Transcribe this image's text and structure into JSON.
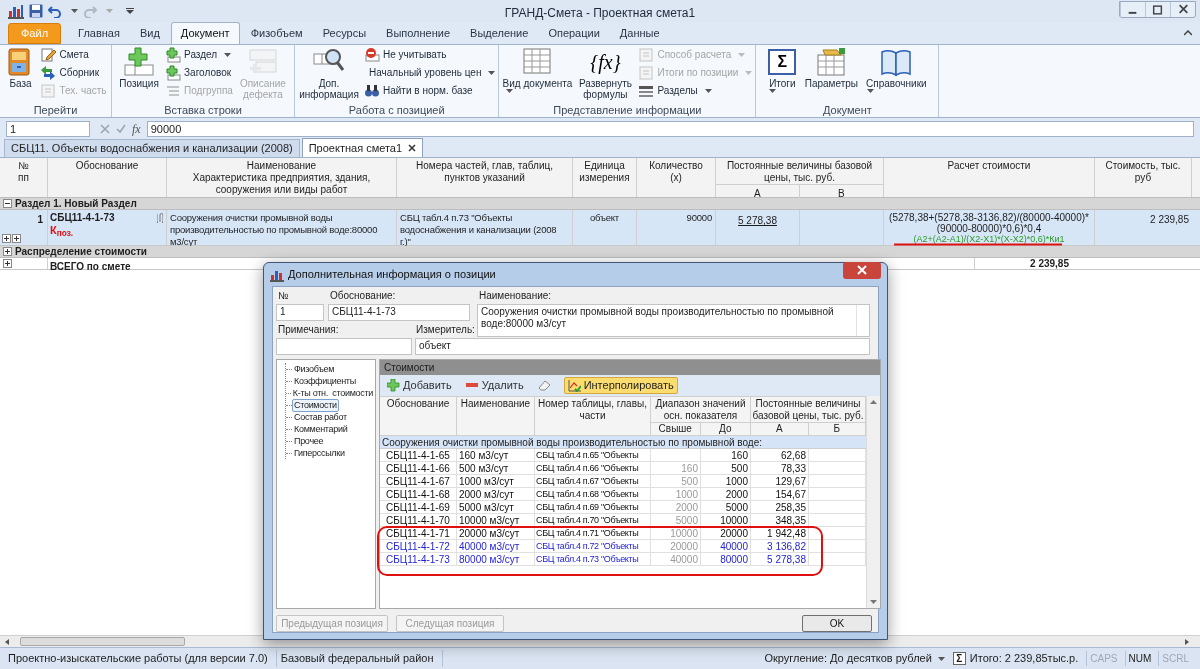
{
  "window": {
    "title": "ГРАНД-Смета - Проектная смета1"
  },
  "ribbon_tabs": [
    {
      "label": "Файл",
      "kind": "file",
      "selected": false
    },
    {
      "label": "Главная",
      "kind": "tab",
      "selected": false
    },
    {
      "label": "Вид",
      "kind": "tab",
      "selected": false
    },
    {
      "label": "Документ",
      "kind": "tab",
      "selected": true
    },
    {
      "label": "Физобъем",
      "kind": "tab",
      "selected": false
    },
    {
      "label": "Ресурсы",
      "kind": "tab",
      "selected": false
    },
    {
      "label": "Выполнение",
      "kind": "tab",
      "selected": false
    },
    {
      "label": "Выделение",
      "kind": "tab",
      "selected": false
    },
    {
      "label": "Операции",
      "kind": "tab",
      "selected": false
    },
    {
      "label": "Данные",
      "kind": "tab",
      "selected": false
    }
  ],
  "ribbon_groups": [
    {
      "title": "Перейти",
      "items": [
        {
          "kind": "large",
          "label": "База",
          "disabled": false,
          "dropdown": false
        },
        {
          "kind": "small",
          "label": "Смета",
          "disabled": false,
          "dropdown": false
        },
        {
          "kind": "small",
          "label": "Сборник",
          "disabled": false,
          "dropdown": false
        },
        {
          "kind": "small",
          "label": "Тех. часть",
          "disabled": true,
          "dropdown": false
        }
      ]
    },
    {
      "title": "Вставка строки",
      "items": [
        {
          "kind": "large",
          "label": "Позиция",
          "disabled": false,
          "dropdown": false
        },
        {
          "kind": "small",
          "label": "Раздел",
          "disabled": false,
          "dropdown": true
        },
        {
          "kind": "small",
          "label": "Заголовок",
          "disabled": false,
          "dropdown": false
        },
        {
          "kind": "small",
          "label": "Подгруппа",
          "disabled": true,
          "dropdown": false
        },
        {
          "kind": "large",
          "label": "Описание дефекта",
          "disabled": true,
          "dropdown": false
        }
      ]
    },
    {
      "title": "Работа с позицией",
      "items": [
        {
          "kind": "large",
          "label": "Доп. информация",
          "disabled": false,
          "dropdown": false
        },
        {
          "kind": "small",
          "label": "Не учитывать",
          "disabled": false,
          "dropdown": false
        },
        {
          "kind": "small",
          "label": "Начальный уровень цен",
          "disabled": false,
          "dropdown": true
        },
        {
          "kind": "small",
          "label": "Найти в норм. базе",
          "disabled": false,
          "dropdown": false
        }
      ]
    },
    {
      "title": "Представление информации",
      "items": [
        {
          "kind": "large",
          "label": "Вид документа",
          "disabled": false,
          "dropdown": true
        },
        {
          "kind": "large",
          "label": "Развернуть формулы",
          "icon_text": "{fx}",
          "disabled": false,
          "dropdown": false
        },
        {
          "kind": "small",
          "label": "Способ расчета",
          "disabled": true,
          "dropdown": true
        },
        {
          "kind": "small",
          "label": "Итоги по позиции",
          "disabled": true,
          "dropdown": true
        },
        {
          "kind": "small",
          "label": "Разделы",
          "disabled": false,
          "dropdown": true
        }
      ]
    },
    {
      "title": "Документ",
      "items": [
        {
          "kind": "large",
          "label": "Итоги",
          "icon_text": "Σ",
          "disabled": false,
          "dropdown": true
        },
        {
          "kind": "large",
          "label": "Параметры",
          "disabled": false,
          "dropdown": false
        },
        {
          "kind": "large",
          "label": "Справочники",
          "disabled": false,
          "dropdown": true
        }
      ]
    }
  ],
  "formula_bar": {
    "cell": "1",
    "function_label": "fx",
    "value": "90000"
  },
  "document_tabs": [
    {
      "label": "СБЦ11. Объекты водоснабжения и канализации (2008)",
      "selected": false
    },
    {
      "label": "Проектная смета1",
      "selected": true
    }
  ],
  "grid": {
    "columns": [
      {
        "label": "№ пп"
      },
      {
        "label": "Обоснование"
      },
      {
        "label": "Наименование\nХарактеристика предприятия, здания, сооружения или виды работ"
      },
      {
        "label": "Номера частей, глав, таблиц, пунктов указаний"
      },
      {
        "label": "Единица измерения"
      },
      {
        "label": "Количество\n(x)"
      },
      {
        "label": "Постоянные величины базовой цены, тыс. руб.",
        "subcolumns": [
          "А",
          "В"
        ]
      },
      {
        "label": "Расчет стоимости"
      },
      {
        "label": "Стоимость, тыс. руб"
      }
    ],
    "rows": [
      {
        "kind": "section",
        "label": "Раздел 1. Новый Раздел",
        "expanded": true
      },
      {
        "kind": "position",
        "selected": true,
        "number": "1",
        "code": "СБЦ11-4-1-73",
        "mark": "К$_{поз.}$",
        "name": "Сооружения очистки промывной воды производительностью по промывной воде:80000 м3/сут",
        "parts": "СБЦ табл.4 п.73 \"Объекты водоснабжения и канализации (2008 г.)\"",
        "unit": "объект",
        "quantity": "90000",
        "a": "5 278,38",
        "formula": "(5278,38+(5278,38-3136,82)/(80000-40000)*(90000-80000)*0,6)*0,4",
        "formula_symbolic": "(A2+(A2-A1)/(X2-X1)*(X-X2)*0,6)*Ки1",
        "cost": "2 239,85"
      },
      {
        "kind": "section",
        "label": "Распределение стоимости",
        "expanded": false
      },
      {
        "kind": "total",
        "label": "ВСЕГО по смете",
        "cost": "2 239,85"
      }
    ]
  },
  "dialog": {
    "title": "Дополнительная информация о позиции",
    "fields": [
      {
        "label": "№",
        "value": "1"
      },
      {
        "label": "Обоснование:",
        "value": "СБЦ11-4-1-73"
      },
      {
        "label": "Наименование:",
        "value": "Сооружения очистки промывной воды производительностью по промывной воде:80000 м3/сут"
      },
      {
        "label": "Примечания:"
      },
      {
        "label": "Измеритель:",
        "value": "объект"
      }
    ],
    "nav": [
      {
        "label": "Физобъем",
        "selected": false
      },
      {
        "label": "Коэффициенты",
        "selected": false
      },
      {
        "label": "К-ты отн.  стоимости",
        "selected": false
      },
      {
        "label": "Стоимости",
        "selected": true
      },
      {
        "label": "Состав работ",
        "selected": false
      },
      {
        "label": "Комментарий",
        "selected": false
      },
      {
        "label": "Прочее",
        "selected": false
      },
      {
        "label": "Гиперссылки",
        "selected": false
      }
    ],
    "panel_title": "Стоимости",
    "toolbar": [
      {
        "kind": "add",
        "label": "Добавить",
        "active": false
      },
      {
        "kind": "remove",
        "label": "Удалить",
        "active": false
      },
      {
        "kind": "clear",
        "active": false
      },
      {
        "kind": "interpolate",
        "label": "Интерполировать",
        "active": true
      }
    ],
    "table": {
      "columns": [
        {
          "label": "Обоснование"
        },
        {
          "label": "Наименование"
        },
        {
          "label": "Номер таблицы, главы, части"
        },
        {
          "label": "Диапазон значений осн. показателя",
          "subcolumns": [
            "Свыше",
            "До"
          ]
        },
        {
          "label": "Постоянные величины базовой цены, тыс. руб.",
          "subcolumns": [
            "А",
            "Б"
          ]
        }
      ],
      "group_label": "Сооружения очистки промывной воды производительностью по промывной воде:",
      "rows": [
        {
          "code": "СБЦ11-4-1-65",
          "name": "160 м3/сут",
          "table_ref": "СБЦ табл.4 п.65 \"Объекты",
          "to": "160",
          "a": "62,68",
          "highlighted": false
        },
        {
          "code": "СБЦ11-4-1-66",
          "name": "500 м3/сут",
          "table_ref": "СБЦ табл.4 п.66 \"Объекты",
          "from": "160",
          "to": "500",
          "a": "78,33",
          "highlighted": false
        },
        {
          "code": "СБЦ11-4-1-67",
          "name": "1000 м3/сут",
          "table_ref": "СБЦ табл.4 п.67 \"Объекты",
          "from": "500",
          "to": "1000",
          "a": "129,67",
          "highlighted": false
        },
        {
          "code": "СБЦ11-4-1-68",
          "name": "2000 м3/сут",
          "table_ref": "СБЦ табл.4 п.68 \"Объекты",
          "from": "1000",
          "to": "2000",
          "a": "154,67",
          "highlighted": false
        },
        {
          "code": "СБЦ11-4-1-69",
          "name": "5000 м3/сут",
          "table_ref": "СБЦ табл.4 п.69 \"Объекты",
          "from": "2000",
          "to": "5000",
          "a": "258,35",
          "highlighted": false
        },
        {
          "code": "СБЦ11-4-1-70",
          "name": "10000 м3/сут",
          "table_ref": "СБЦ табл.4 п.70 \"Объекты",
          "from": "5000",
          "to": "10000",
          "a": "348,35",
          "highlighted": false
        },
        {
          "code": "СБЦ11-4-1-71",
          "name": "20000 м3/сут",
          "table_ref": "СБЦ табл.4 п.71 \"Объекты",
          "from": "10000",
          "to": "20000",
          "a": "1 942,48",
          "highlighted": false
        },
        {
          "code": "СБЦ11-4-1-72",
          "name": "40000 м3/сут",
          "table_ref": "СБЦ табл.4 п.72 \"Объекты",
          "from": "20000",
          "to": "40000",
          "a": "3 136,82",
          "highlighted": true
        },
        {
          "code": "СБЦ11-4-1-73",
          "name": "80000 м3/сут",
          "table_ref": "СБЦ табл.4 п.73 \"Объекты",
          "from": "40000",
          "to": "80000",
          "a": "5 278,38",
          "highlighted": true
        }
      ]
    },
    "buttons": [
      {
        "label": "Предыдущая позиция",
        "disabled": true
      },
      {
        "label": "Следущая позиция",
        "disabled": true
      },
      {
        "label": "OK",
        "disabled": false
      }
    ]
  },
  "status_bar": {
    "left": [
      "Проектно-изыскательские работы (для версии 7.0)",
      "Базовый федеральный район"
    ],
    "rounding": "Округление: До десятков рублей",
    "sum_symbol": "Σ",
    "total": "Итого: 2 239,85тыс.р.",
    "indicators": [
      {
        "label": "CAPS",
        "on": false
      },
      {
        "label": "NUM",
        "on": true
      },
      {
        "label": "SCRL",
        "on": false
      }
    ]
  }
}
